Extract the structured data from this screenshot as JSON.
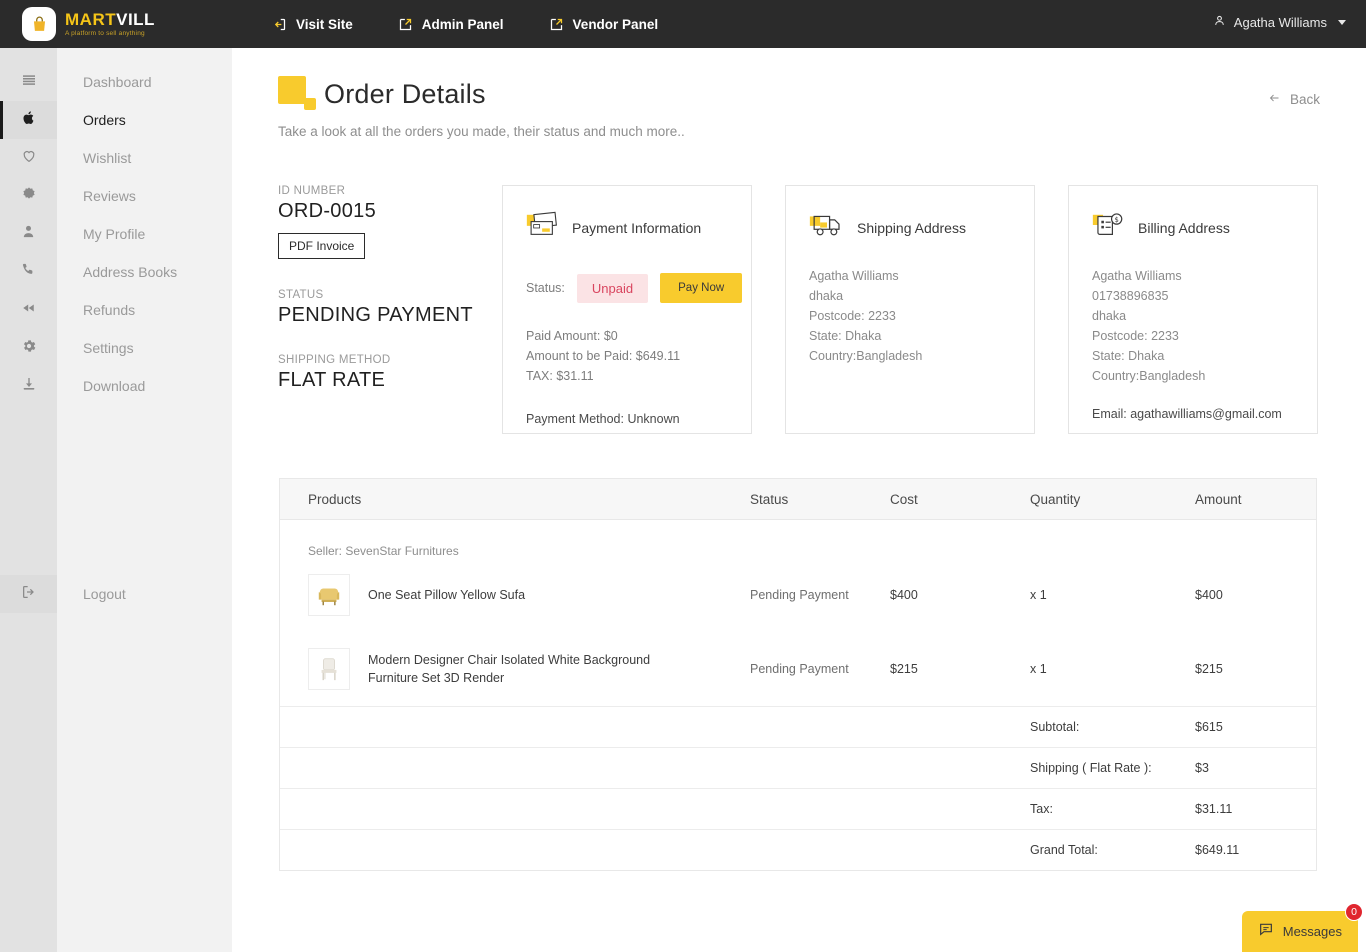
{
  "brand": {
    "name_first": "MART",
    "name_second": "VILL",
    "tagline": "A platform to sell anything",
    "accent_color": "#f8cb2d",
    "logo_icon": "shopping-bag-icon"
  },
  "topnav": {
    "items": [
      {
        "label": "Visit Site",
        "icon": "enter-arrow-icon"
      },
      {
        "label": "Admin Panel",
        "icon": "external-link-icon"
      },
      {
        "label": "Vendor Panel",
        "icon": "external-link-icon"
      }
    ],
    "user": {
      "name": "Agatha Williams",
      "icon": "person-icon"
    }
  },
  "sidebar": {
    "items": [
      {
        "label": "Dashboard",
        "icon": "list-lines-icon",
        "active": false
      },
      {
        "label": "Orders",
        "icon": "shopping-bag-icon",
        "active": true
      },
      {
        "label": "Wishlist",
        "icon": "heart-icon",
        "active": false
      },
      {
        "label": "Reviews",
        "icon": "badge-star-icon",
        "active": false
      },
      {
        "label": "My Profile",
        "icon": "person-icon",
        "active": false
      },
      {
        "label": "Address Books",
        "icon": "phone-icon",
        "active": false
      },
      {
        "label": "Refunds",
        "icon": "rewind-icon",
        "active": false
      },
      {
        "label": "Settings",
        "icon": "gear-icon",
        "active": false
      },
      {
        "label": "Download",
        "icon": "download-icon",
        "active": false
      }
    ],
    "logout": {
      "label": "Logout",
      "icon": "logout-icon"
    }
  },
  "header": {
    "title": "Order Details",
    "subtitle": "Take a look at all the orders you made, their status and much more..",
    "back_label": "Back",
    "back_icon": "arrow-left-icon"
  },
  "order_meta": {
    "id_label": "ID NUMBER",
    "id_value": "ORD-0015",
    "pdf_button": "PDF Invoice",
    "status_label": "STATUS",
    "status_value": "PENDING PAYMENT",
    "shipping_label": "SHIPPING METHOD",
    "shipping_value": "FLAT RATE"
  },
  "payment_card": {
    "title": "Payment Information",
    "icon": "credit-cards-icon",
    "status_label": "Status:",
    "status_badge": "Unpaid",
    "pay_button": "Pay Now",
    "paid_amount": "Paid Amount: $0",
    "amount_to_be_paid": "Amount to be Paid: $649.11",
    "tax": "TAX: $31.11",
    "payment_method": "Payment Method: Unknown"
  },
  "shipping_card": {
    "title": "Shipping Address",
    "icon": "delivery-truck-icon",
    "lines": [
      "Agatha Williams",
      "dhaka",
      "Postcode: 2233",
      "State: Dhaka",
      "Country:Bangladesh"
    ]
  },
  "billing_card": {
    "title": "Billing Address",
    "icon": "invoice-dollar-icon",
    "lines": [
      "Agatha Williams",
      "01738896835",
      "dhaka",
      "Postcode: 2233",
      "State: Dhaka",
      "Country:Bangladesh"
    ],
    "email": "Email: agathawilliams@gmail.com"
  },
  "products_table": {
    "headers": {
      "products": "Products",
      "status": "Status",
      "cost": "Cost",
      "quantity": "Quantity",
      "amount": "Amount"
    },
    "seller": "Seller: SevenStar Furnitures",
    "rows": [
      {
        "name": "One Seat Pillow Yellow Sufa",
        "thumb": "yellow-sofa-thumbnail",
        "status": "Pending Payment",
        "cost": "$400",
        "quantity": "x 1",
        "amount": "$400"
      },
      {
        "name": "Modern Designer Chair Isolated White Background Furniture Set 3D Render",
        "thumb": "white-chair-thumbnail",
        "status": "Pending Payment",
        "cost": "$215",
        "quantity": "x 1",
        "amount": "$215"
      }
    ],
    "totals": [
      {
        "label": "Subtotal:",
        "value": "$615"
      },
      {
        "label": "Shipping ( Flat Rate ):",
        "value": "$3"
      },
      {
        "label": "Tax:",
        "value": "$31.11"
      },
      {
        "label": "Grand Total:",
        "value": "$649.11"
      }
    ]
  },
  "messages_widget": {
    "label": "Messages",
    "count": "0",
    "icon": "chat-bubble-icon",
    "badge_color": "#e0262f"
  }
}
